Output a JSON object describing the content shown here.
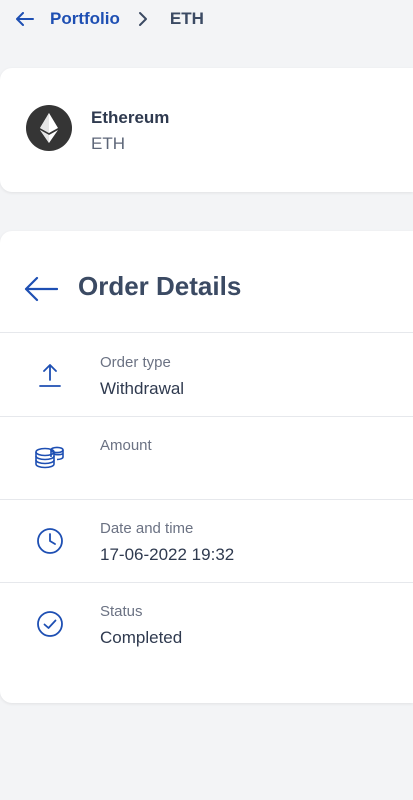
{
  "breadcrumb": {
    "parent": "Portfolio",
    "current": "ETH"
  },
  "asset": {
    "name": "Ethereum",
    "symbol": "ETH"
  },
  "order_details": {
    "title": "Order Details",
    "rows": [
      {
        "label": "Order type",
        "value": "Withdrawal",
        "icon": "upload-icon"
      },
      {
        "label": "Amount",
        "value": "",
        "icon": "coins-icon"
      },
      {
        "label": "Date and time",
        "value": "17-06-2022 19:32",
        "icon": "clock-icon"
      },
      {
        "label": "Status",
        "value": "Completed",
        "icon": "check-circle-icon"
      }
    ]
  },
  "colors": {
    "accent": "#1e4fb3",
    "background": "#f3f4f6",
    "card": "#ffffff",
    "asset_icon_bg": "#353535"
  }
}
